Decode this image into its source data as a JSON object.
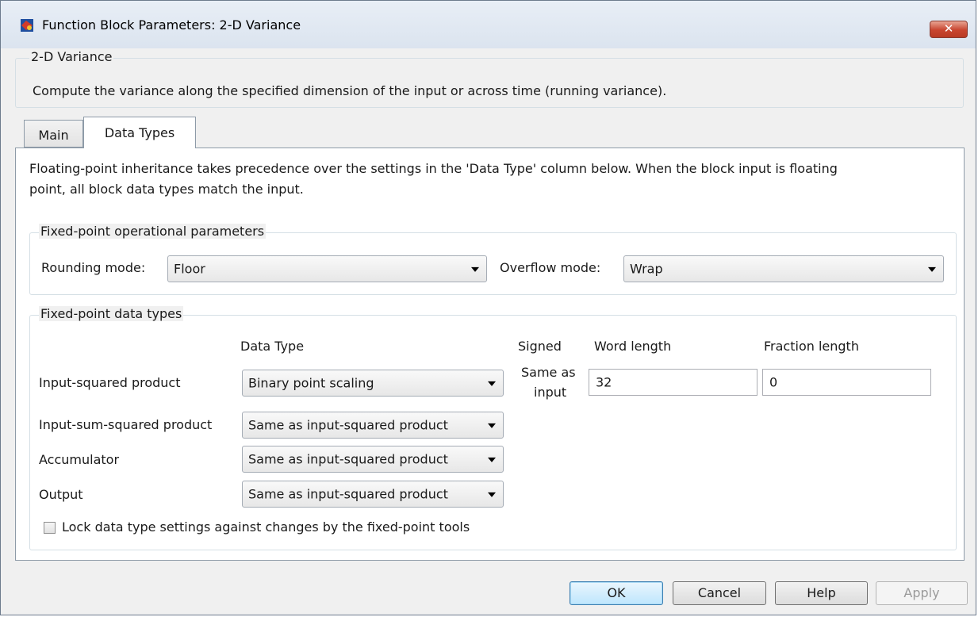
{
  "window": {
    "title": "Function Block Parameters: 2-D Variance",
    "close_glyph": "✕"
  },
  "block": {
    "group_label": "2-D Variance",
    "description": "Compute the variance along the specified dimension of the input or across time (running variance)."
  },
  "tabs": [
    {
      "label": "Main"
    },
    {
      "label": "Data Types"
    }
  ],
  "data_types": {
    "note_line1": "Floating-point inheritance takes precedence over the settings in the 'Data Type' column below. When the block input is floating",
    "note_line2": "point, all block data types match the input.",
    "operational": {
      "group_label": "Fixed-point operational parameters",
      "rounding_label": "Rounding mode:",
      "rounding_value": "Floor",
      "overflow_label": "Overflow mode:",
      "overflow_value": "Wrap"
    },
    "fixed_types": {
      "group_label": "Fixed-point data types",
      "headers": {
        "data_type": "Data Type",
        "signed": "Signed",
        "word_length": "Word length",
        "fraction_length": "Fraction length"
      },
      "rows": [
        {
          "label": "Input-squared product",
          "data_type": "Binary point scaling",
          "signed_line1": "Same as",
          "signed_line2": "input",
          "word_length": "32",
          "fraction_length": "0"
        },
        {
          "label": "Input-sum-squared product",
          "data_type": "Same as input-squared product"
        },
        {
          "label": "Accumulator",
          "data_type": "Same as input-squared product"
        },
        {
          "label": "Output",
          "data_type": "Same as input-squared product"
        }
      ],
      "lock_label": "Lock data type settings against changes by the fixed-point tools",
      "lock_checked": false
    }
  },
  "buttons": {
    "ok": "OK",
    "cancel": "Cancel",
    "help": "Help",
    "apply": "Apply"
  }
}
